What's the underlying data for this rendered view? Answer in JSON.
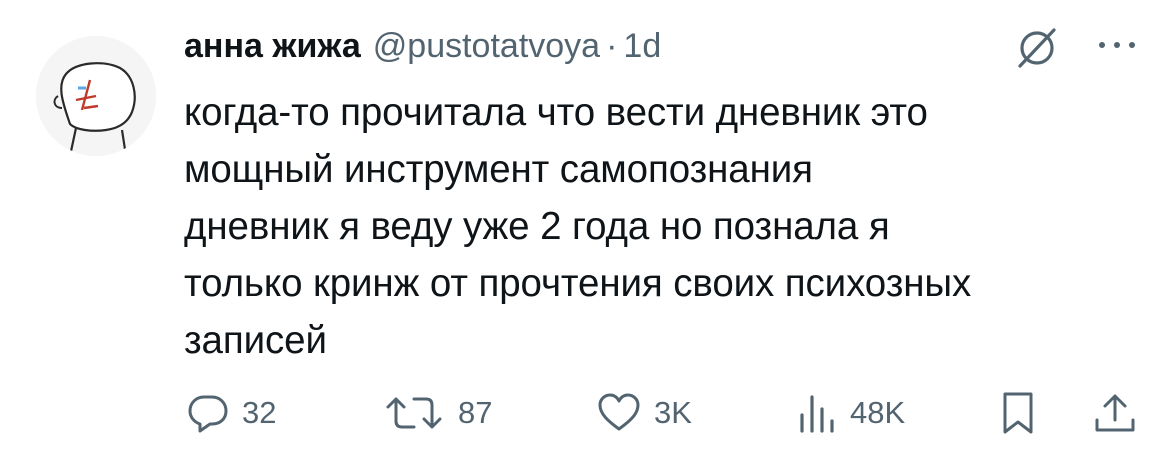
{
  "tweet": {
    "display_name": "анна жижа",
    "handle": "@pustotatvoya",
    "separator": "·",
    "time": "1d",
    "text": "когда-то прочитала что вести дневник это\nмощный инструмент самопознания\nдневник я веду уже 2 года но познала я\nтолько кринж от прочтения своих психозных\nзаписей"
  },
  "actions": {
    "replies": "32",
    "reposts": "87",
    "likes": "3K",
    "views": "48K"
  },
  "icons": {
    "header": [
      "grok-icon",
      "more-icon"
    ],
    "actions": [
      "reply-icon",
      "repost-icon",
      "like-icon",
      "views-icon",
      "bookmark-icon",
      "share-icon"
    ]
  },
  "colors": {
    "text": "#0f1419",
    "secondary": "#536471",
    "background": "#ffffff"
  }
}
